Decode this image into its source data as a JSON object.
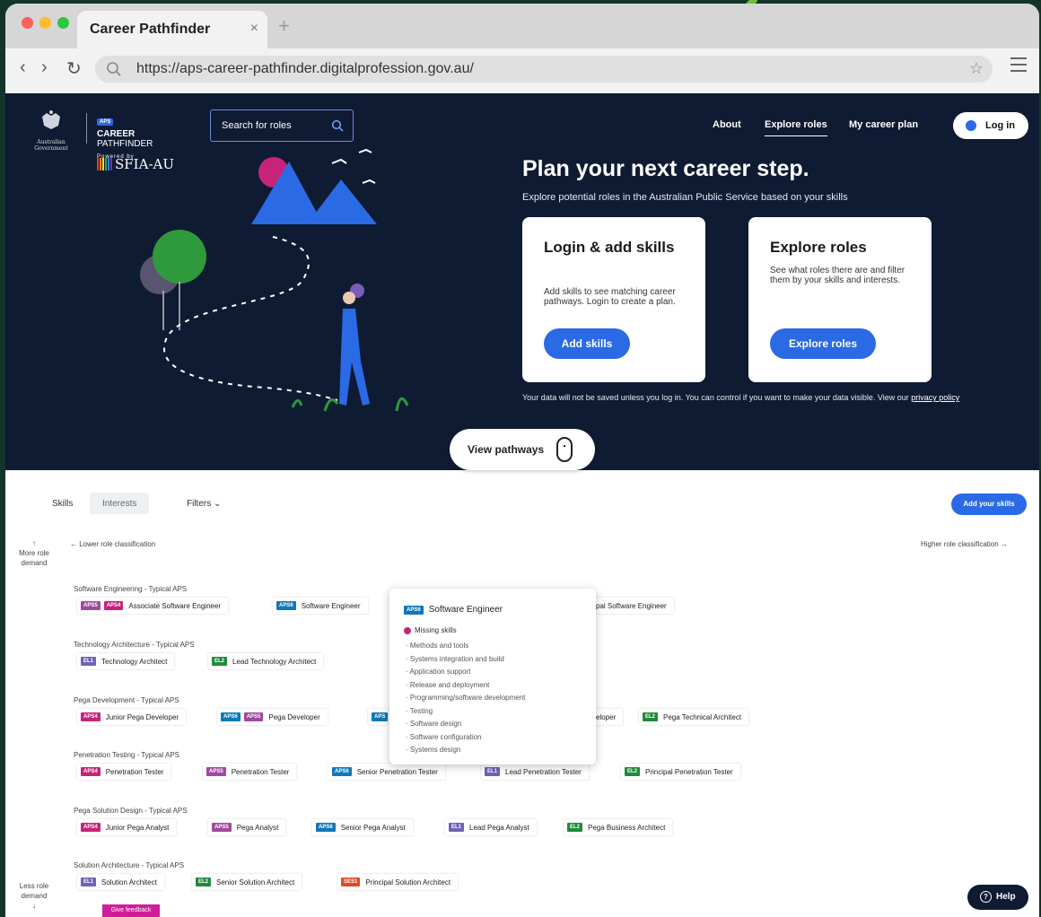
{
  "browser": {
    "tab_title": "Career Pathfinder",
    "tab_close": "×",
    "new_tab": "+",
    "back": "‹",
    "forward": "›",
    "reload": "↻",
    "url": "https://aps-career-pathfinder.digitalprofession.gov.au/",
    "star": "☆"
  },
  "header": {
    "gov_text": "Australian Government",
    "aps_badge": "APS",
    "brand_line1": "CAREER",
    "brand_line2": "PATHFINDER",
    "powered_by": "Powered by",
    "sfia": "SFIA-AU",
    "search_placeholder": "Search for roles",
    "nav": [
      "About",
      "Explore roles",
      "My career plan"
    ],
    "login": "Log in"
  },
  "hero": {
    "title": "Plan your next career step.",
    "subtitle": "Explore potential roles in the Australian Public Service based on your skills",
    "card_login": {
      "title": "Login & add skills",
      "text": "Add skills to see matching career pathways. Login to create a plan.",
      "button": "Add skills"
    },
    "card_explore": {
      "title": "Explore roles",
      "text": "See what roles there are and filter them by your skills and interests.",
      "button": "Explore roles"
    },
    "privacy_text": "Your data will not be saved unless you log in. You can control if you want to make your data visible. View our",
    "privacy_link": "privacy policy",
    "view_pathways": "View pathways"
  },
  "pathways": {
    "tab_skills": "Skills",
    "tab_interests": "Interests",
    "filters": "Filters ⌄",
    "add_skills": "Add your skills",
    "more_demand": "More role demand",
    "less_demand": "Less role demand",
    "lower_class": "← Lower role classification",
    "higher_class": "Higher role classification →",
    "groups": [
      "Software Engineering - Typical APS",
      "Technology Architecture - Typical APS",
      "Pega Development - Typical APS",
      "Penetration Testing - Typical APS",
      "Pega Solution Design - Typical APS",
      "Solution Architecture - Typical APS"
    ],
    "roles": {
      "se_assoc": {
        "b1": "APS5",
        "b2": "APS4",
        "label": "Associate Software Engineer"
      },
      "se_eng": {
        "b1": "APS6",
        "label": "Software Engineer"
      },
      "se_principal": {
        "label": "pal Software Engineer"
      },
      "ta_arch": {
        "b1": "EL1",
        "label": "Technology Architect"
      },
      "ta_lead": {
        "b1": "EL2",
        "label": "Lead Technology Architect"
      },
      "pd_junior": {
        "b1": "APS4",
        "label": "Junior Pega Developer"
      },
      "pd_dev": {
        "b1": "APS6",
        "b2": "APS5",
        "label": "Pega Developer"
      },
      "pd_apsx": {
        "b1": "APS"
      },
      "pd_eloper": {
        "label": "eloper"
      },
      "pd_tech": {
        "b1": "EL2",
        "label": "Pega Technical Architect"
      },
      "pt_1": {
        "b1": "APS4",
        "label": "Penetration Tester"
      },
      "pt_2": {
        "b1": "APS5",
        "label": "Penetration Tester"
      },
      "pt_3": {
        "b1": "APS6",
        "label": "Senior Penetration Tester"
      },
      "pt_4": {
        "b1": "EL1",
        "label": "Lead Penetration Tester"
      },
      "pt_5": {
        "b1": "EL2",
        "label": "Principal Penetration Tester"
      },
      "ps_1": {
        "b1": "APS4",
        "label": "Junior Pega Analyst"
      },
      "ps_2": {
        "b1": "APS5",
        "label": "Pega Analyst"
      },
      "ps_3": {
        "b1": "APS6",
        "label": "Senior Pega Analyst"
      },
      "ps_4": {
        "b1": "EL1",
        "label": "Lead Pega Analyst"
      },
      "ps_5": {
        "b1": "EL2",
        "label": "Pega Business Architect"
      },
      "sa_1": {
        "b1": "EL1",
        "label": "Solution Architect"
      },
      "sa_2": {
        "b1": "EL2",
        "label": "Senior Solution Architect"
      },
      "sa_3": {
        "b1": "SES1",
        "label": "Principal Solution Architect"
      }
    },
    "popup": {
      "badge": "APS6",
      "title": "Software Engineer",
      "missing": "Missing skills",
      "items": [
        "Methods and tools",
        "Systems integration and build",
        "Application support",
        "Release and deployment",
        "Programming/software development",
        "Testing",
        "Software design",
        "Software configuration",
        "Systems design"
      ]
    },
    "help": "Help",
    "help_icon": "?",
    "feedback": "Give feedback"
  },
  "colors": {
    "hero_bg": "#0f1b33",
    "accent_blue": "#2a6ae5",
    "aps4": "#c8237b",
    "aps5": "#a0499e",
    "aps6": "#1178b5",
    "el1": "#7261b5",
    "el2": "#208a3c",
    "ses1": "#e04b22"
  }
}
